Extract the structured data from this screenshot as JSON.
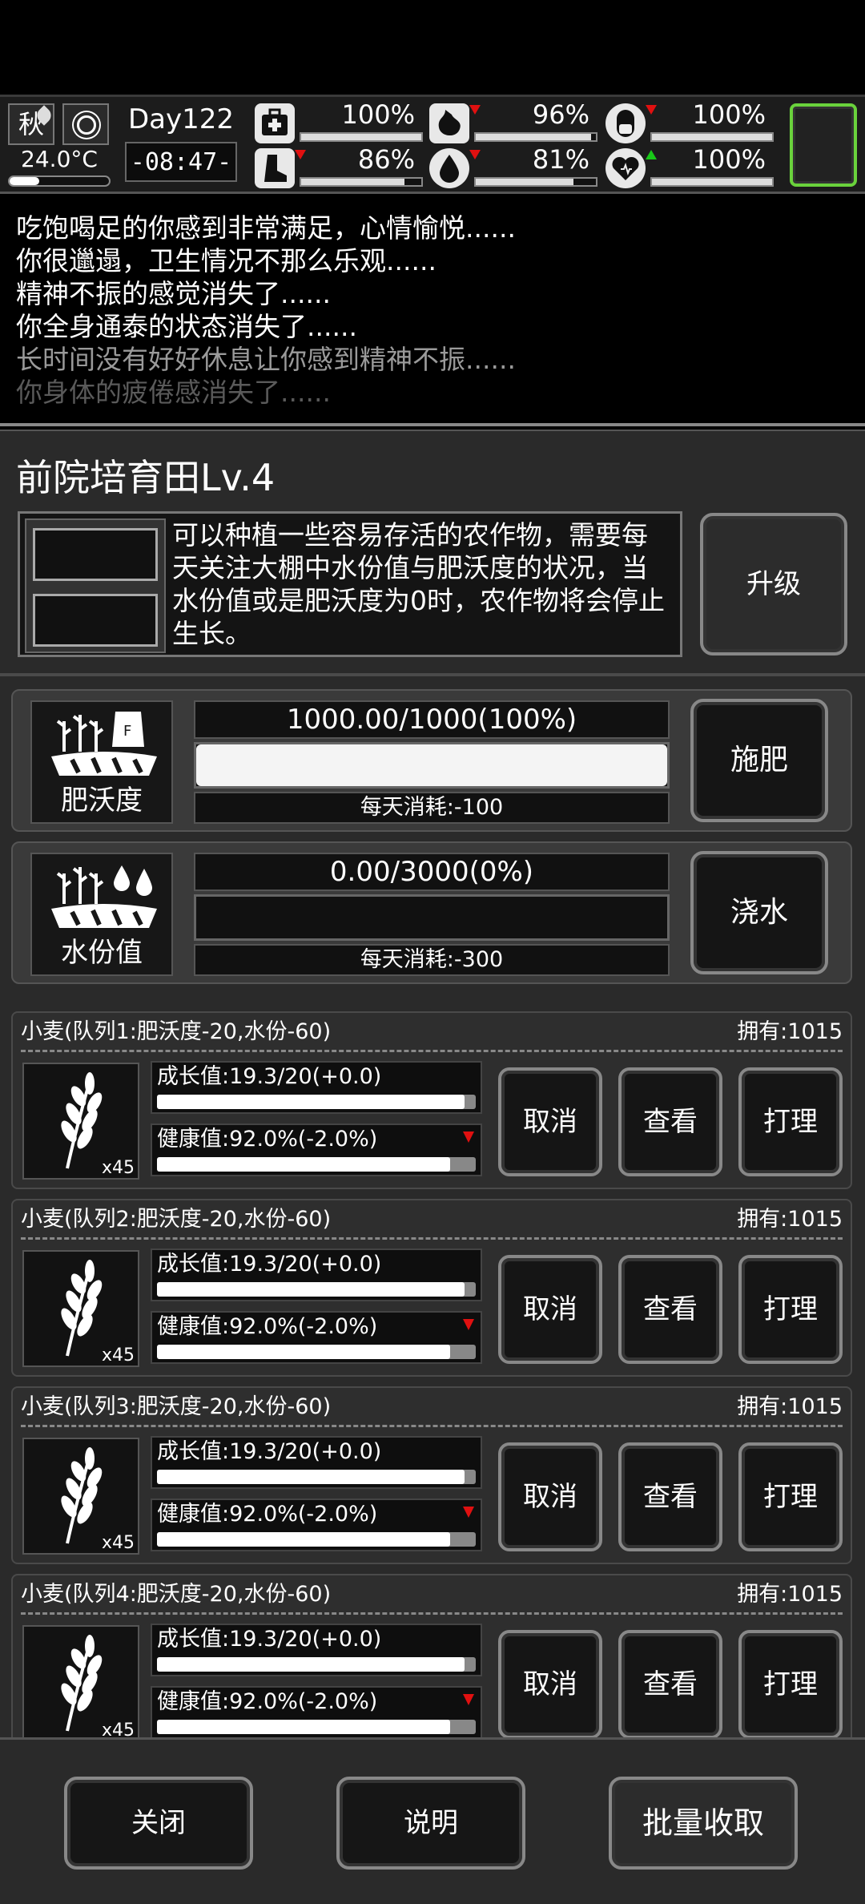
{
  "status": {
    "season": "秋",
    "temperature": "24.0°C",
    "day": "Day122",
    "clock": "-08:47-",
    "stats": [
      {
        "name": "health-icon",
        "value": "100%",
        "level": 1.0,
        "arrow": ""
      },
      {
        "name": "stomach-icon",
        "value": "96%",
        "level": 0.96,
        "arrow": "down"
      },
      {
        "name": "capsule-icon",
        "value": "100%",
        "level": 1.0,
        "arrow": "down"
      },
      {
        "name": "foot-icon",
        "value": "86%",
        "level": 0.86,
        "arrow": "down"
      },
      {
        "name": "water-drop-icon",
        "value": "81%",
        "level": 0.81,
        "arrow": "down"
      },
      {
        "name": "heart-icon",
        "value": "100%",
        "level": 1.0,
        "arrow": "up"
      }
    ]
  },
  "log": [
    "吃饱喝足的你感到非常满足，心情愉悦......",
    "你很邋遢，卫生情况不那么乐观......",
    "精神不振的感觉消失了......",
    "你全身通泰的状态消失了......",
    "长时间没有好好休息让你感到精神不振......",
    "你身体的疲倦感消失了......"
  ],
  "panel": {
    "title": "前院培育田Lv.4",
    "description": "可以种植一些容易存活的农作物，需要每天关注大棚中水份值与肥沃度的状况，当水份值或是肥沃度为0时，农作物将会停止生长。",
    "upgrade_label": "升级"
  },
  "fertility": {
    "label": "肥沃度",
    "value": "1000.00/1000(100%)",
    "level": 1.0,
    "cost": "每天消耗:-100",
    "action": "施肥"
  },
  "water": {
    "label": "水份值",
    "value": "0.00/3000(0%)",
    "level": 0.0,
    "cost": "每天消耗:-300",
    "action": "浇水"
  },
  "crops": [
    {
      "header": "小麦(队列1:肥沃度-20,水份-60)",
      "owned": "拥有:1015",
      "count": "x45",
      "growth": "成长值:19.3/20(+0.0)",
      "growth_level": 0.965,
      "health": "健康值:92.0%(-2.0%)",
      "health_level": 0.92,
      "cancel": "取消",
      "view": "查看",
      "tend": "打理"
    },
    {
      "header": "小麦(队列2:肥沃度-20,水份-60)",
      "owned": "拥有:1015",
      "count": "x45",
      "growth": "成长值:19.3/20(+0.0)",
      "growth_level": 0.965,
      "health": "健康值:92.0%(-2.0%)",
      "health_level": 0.92,
      "cancel": "取消",
      "view": "查看",
      "tend": "打理"
    },
    {
      "header": "小麦(队列3:肥沃度-20,水份-60)",
      "owned": "拥有:1015",
      "count": "x45",
      "growth": "成长值:19.3/20(+0.0)",
      "growth_level": 0.965,
      "health": "健康值:92.0%(-2.0%)",
      "health_level": 0.92,
      "cancel": "取消",
      "view": "查看",
      "tend": "打理"
    },
    {
      "header": "小麦(队列4:肥沃度-20,水份-60)",
      "owned": "拥有:1015",
      "count": "x45",
      "growth": "成长值:19.3/20(+0.0)",
      "growth_level": 0.965,
      "health": "健康值:92.0%(-2.0%)",
      "health_level": 0.92,
      "cancel": "取消",
      "view": "查看",
      "tend": "打理"
    }
  ],
  "footer": {
    "close": "关闭",
    "help": "说明",
    "harvest": "批量收取"
  }
}
